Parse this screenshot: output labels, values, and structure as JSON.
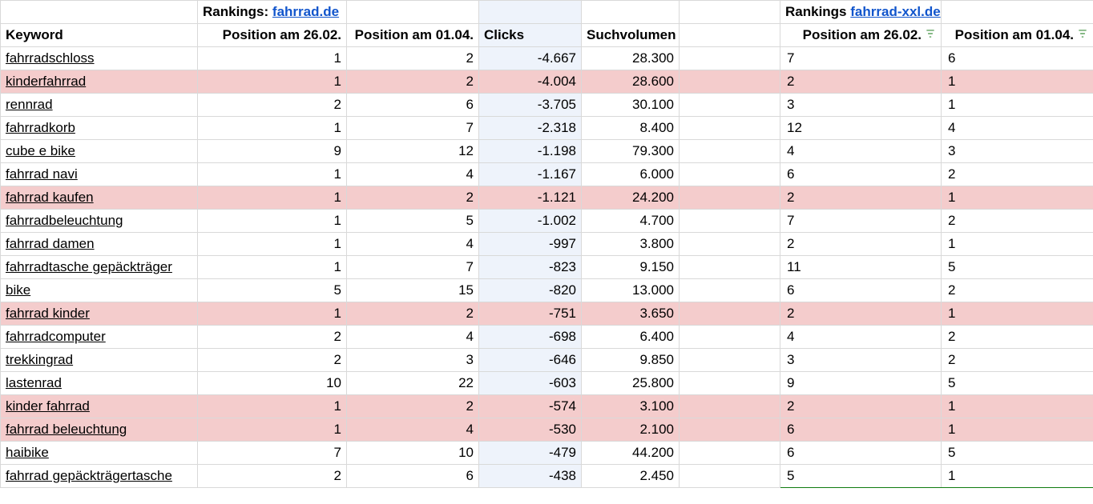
{
  "siteA": {
    "rankings_label": "Rankings:",
    "site_link": "fahrrad.de"
  },
  "siteB": {
    "rankings_label": "Rankings",
    "site_link": "fahrrad-xxl.de"
  },
  "headers": {
    "keyword": "Keyword",
    "posA1": "Position am 26.02.",
    "posA2": "Position am 01.04.",
    "clicks": "Clicks",
    "volume": "Suchvolumen",
    "posB1": "Position am 26.02.",
    "posB2": "Position am 01.04."
  },
  "chart_data": {
    "type": "table",
    "columns": [
      "Keyword",
      "Position am 26.02. (fahrrad.de)",
      "Position am 01.04. (fahrrad.de)",
      "Clicks",
      "Suchvolumen",
      "Position am 26.02. (fahrrad-xxl.de)",
      "Position am 01.04. (fahrrad-xxl.de)"
    ],
    "rows": [
      {
        "keyword": "fahrradschloss",
        "a1": 1,
        "a2": 2,
        "clicks": "-4.667",
        "vol": "28.300",
        "b1": 7,
        "b2": 6,
        "hl": false
      },
      {
        "keyword": "kinderfahrrad",
        "a1": 1,
        "a2": 2,
        "clicks": "-4.004",
        "vol": "28.600",
        "b1": 2,
        "b2": 1,
        "hl": true
      },
      {
        "keyword": "rennrad",
        "a1": 2,
        "a2": 6,
        "clicks": "-3.705",
        "vol": "30.100",
        "b1": 3,
        "b2": 1,
        "hl": false
      },
      {
        "keyword": "fahrradkorb",
        "a1": 1,
        "a2": 7,
        "clicks": "-2.318",
        "vol": "8.400",
        "b1": 12,
        "b2": 4,
        "hl": false
      },
      {
        "keyword": "cube e bike",
        "a1": 9,
        "a2": 12,
        "clicks": "-1.198",
        "vol": "79.300",
        "b1": 4,
        "b2": 3,
        "hl": false
      },
      {
        "keyword": "fahrrad navi",
        "a1": 1,
        "a2": 4,
        "clicks": "-1.167",
        "vol": "6.000",
        "b1": 6,
        "b2": 2,
        "hl": false
      },
      {
        "keyword": "fahrrad kaufen",
        "a1": 1,
        "a2": 2,
        "clicks": "-1.121",
        "vol": "24.200",
        "b1": 2,
        "b2": 1,
        "hl": true
      },
      {
        "keyword": "fahrradbeleuchtung",
        "a1": 1,
        "a2": 5,
        "clicks": "-1.002",
        "vol": "4.700",
        "b1": 7,
        "b2": 2,
        "hl": false
      },
      {
        "keyword": "fahrrad damen",
        "a1": 1,
        "a2": 4,
        "clicks": "-997",
        "vol": "3.800",
        "b1": 2,
        "b2": 1,
        "hl": false
      },
      {
        "keyword": "fahrradtasche gepäckträger",
        "a1": 1,
        "a2": 7,
        "clicks": "-823",
        "vol": "9.150",
        "b1": 11,
        "b2": 5,
        "hl": false
      },
      {
        "keyword": "bike",
        "a1": 5,
        "a2": 15,
        "clicks": "-820",
        "vol": "13.000",
        "b1": 6,
        "b2": 2,
        "hl": false
      },
      {
        "keyword": "fahrrad kinder",
        "a1": 1,
        "a2": 2,
        "clicks": "-751",
        "vol": "3.650",
        "b1": 2,
        "b2": 1,
        "hl": true
      },
      {
        "keyword": "fahrradcomputer",
        "a1": 2,
        "a2": 4,
        "clicks": "-698",
        "vol": "6.400",
        "b1": 4,
        "b2": 2,
        "hl": false
      },
      {
        "keyword": "trekkingrad",
        "a1": 2,
        "a2": 3,
        "clicks": "-646",
        "vol": "9.850",
        "b1": 3,
        "b2": 2,
        "hl": false
      },
      {
        "keyword": "lastenrad",
        "a1": 10,
        "a2": 22,
        "clicks": "-603",
        "vol": "25.800",
        "b1": 9,
        "b2": 5,
        "hl": false
      },
      {
        "keyword": "kinder fahrrad",
        "a1": 1,
        "a2": 2,
        "clicks": "-574",
        "vol": "3.100",
        "b1": 2,
        "b2": 1,
        "hl": true
      },
      {
        "keyword": "fahrrad beleuchtung",
        "a1": 1,
        "a2": 4,
        "clicks": "-530",
        "vol": "2.100",
        "b1": 6,
        "b2": 1,
        "hl": true
      },
      {
        "keyword": "haibike",
        "a1": 7,
        "a2": 10,
        "clicks": "-479",
        "vol": "44.200",
        "b1": 6,
        "b2": 5,
        "hl": false
      },
      {
        "keyword": "fahrrad gepäckträgertasche",
        "a1": 2,
        "a2": 6,
        "clicks": "-438",
        "vol": "2.450",
        "b1": 5,
        "b2": 1,
        "hl": false
      }
    ]
  }
}
